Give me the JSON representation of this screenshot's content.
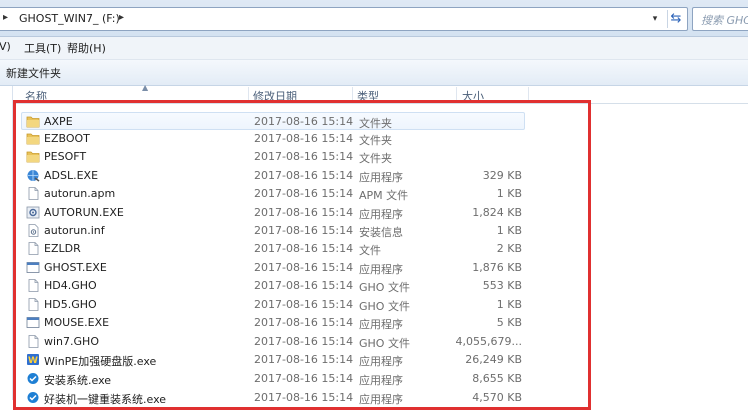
{
  "address": {
    "path": "GHOST_WIN7_ (F:)",
    "search_placeholder": "搜索 GHOST"
  },
  "menu": {
    "items": [
      {
        "label": "V)"
      },
      {
        "label": "工具(T)"
      },
      {
        "label": "帮助(H)"
      }
    ]
  },
  "command_bar": {
    "new_folder": "新建文件夹"
  },
  "columns": {
    "name": "名称",
    "date": "修改日期",
    "type": "类型",
    "size": "大小"
  },
  "files": [
    {
      "name": "AXPE",
      "date": "2017-08-16 15:14",
      "type": "文件夹",
      "size": "",
      "icon": "folder-icon"
    },
    {
      "name": "EZBOOT",
      "date": "2017-08-16 15:14",
      "type": "文件夹",
      "size": "",
      "icon": "folder-icon"
    },
    {
      "name": "PESOFT",
      "date": "2017-08-16 15:14",
      "type": "文件夹",
      "size": "",
      "icon": "folder-icon"
    },
    {
      "name": "ADSL.EXE",
      "date": "2017-08-16 15:14",
      "type": "应用程序",
      "size": "329 KB",
      "icon": "network-exe-icon"
    },
    {
      "name": "autorun.apm",
      "date": "2017-08-16 15:14",
      "type": "APM 文件",
      "size": "1 KB",
      "icon": "file-icon"
    },
    {
      "name": "AUTORUN.EXE",
      "date": "2017-08-16 15:14",
      "type": "应用程序",
      "size": "1,824 KB",
      "icon": "gear-exe-icon"
    },
    {
      "name": "autorun.inf",
      "date": "2017-08-16 15:14",
      "type": "安装信息",
      "size": "1 KB",
      "icon": "settings-file-icon"
    },
    {
      "name": "EZLDR",
      "date": "2017-08-16 15:14",
      "type": "文件",
      "size": "2 KB",
      "icon": "file-icon"
    },
    {
      "name": "GHOST.EXE",
      "date": "2017-08-16 15:14",
      "type": "应用程序",
      "size": "1,876 KB",
      "icon": "window-exe-icon"
    },
    {
      "name": "HD4.GHO",
      "date": "2017-08-16 15:14",
      "type": "GHO 文件",
      "size": "553 KB",
      "icon": "file-icon"
    },
    {
      "name": "HD5.GHO",
      "date": "2017-08-16 15:14",
      "type": "GHO 文件",
      "size": "1 KB",
      "icon": "file-icon"
    },
    {
      "name": "MOUSE.EXE",
      "date": "2017-08-16 15:14",
      "type": "应用程序",
      "size": "5 KB",
      "icon": "window-exe-icon"
    },
    {
      "name": "win7.GHO",
      "date": "2017-08-16 15:14",
      "type": "GHO 文件",
      "size": "4,055,679...",
      "icon": "file-icon"
    },
    {
      "name": "WinPE加强硬盘版.exe",
      "date": "2017-08-16 15:14",
      "type": "应用程序",
      "size": "26,249 KB",
      "icon": "winpe-exe-icon"
    },
    {
      "name": "安装系统.exe",
      "date": "2017-08-16 15:14",
      "type": "应用程序",
      "size": "8,655 KB",
      "icon": "installer-exe-icon"
    },
    {
      "name": "好装机一键重装系统.exe",
      "date": "2017-08-16 15:14",
      "type": "应用程序",
      "size": "4,570 KB",
      "icon": "installer-exe-icon"
    }
  ],
  "colors": {
    "highlight_frame": "#e03030",
    "folder": "#e8c25a",
    "selection": "#cfe0f3"
  }
}
